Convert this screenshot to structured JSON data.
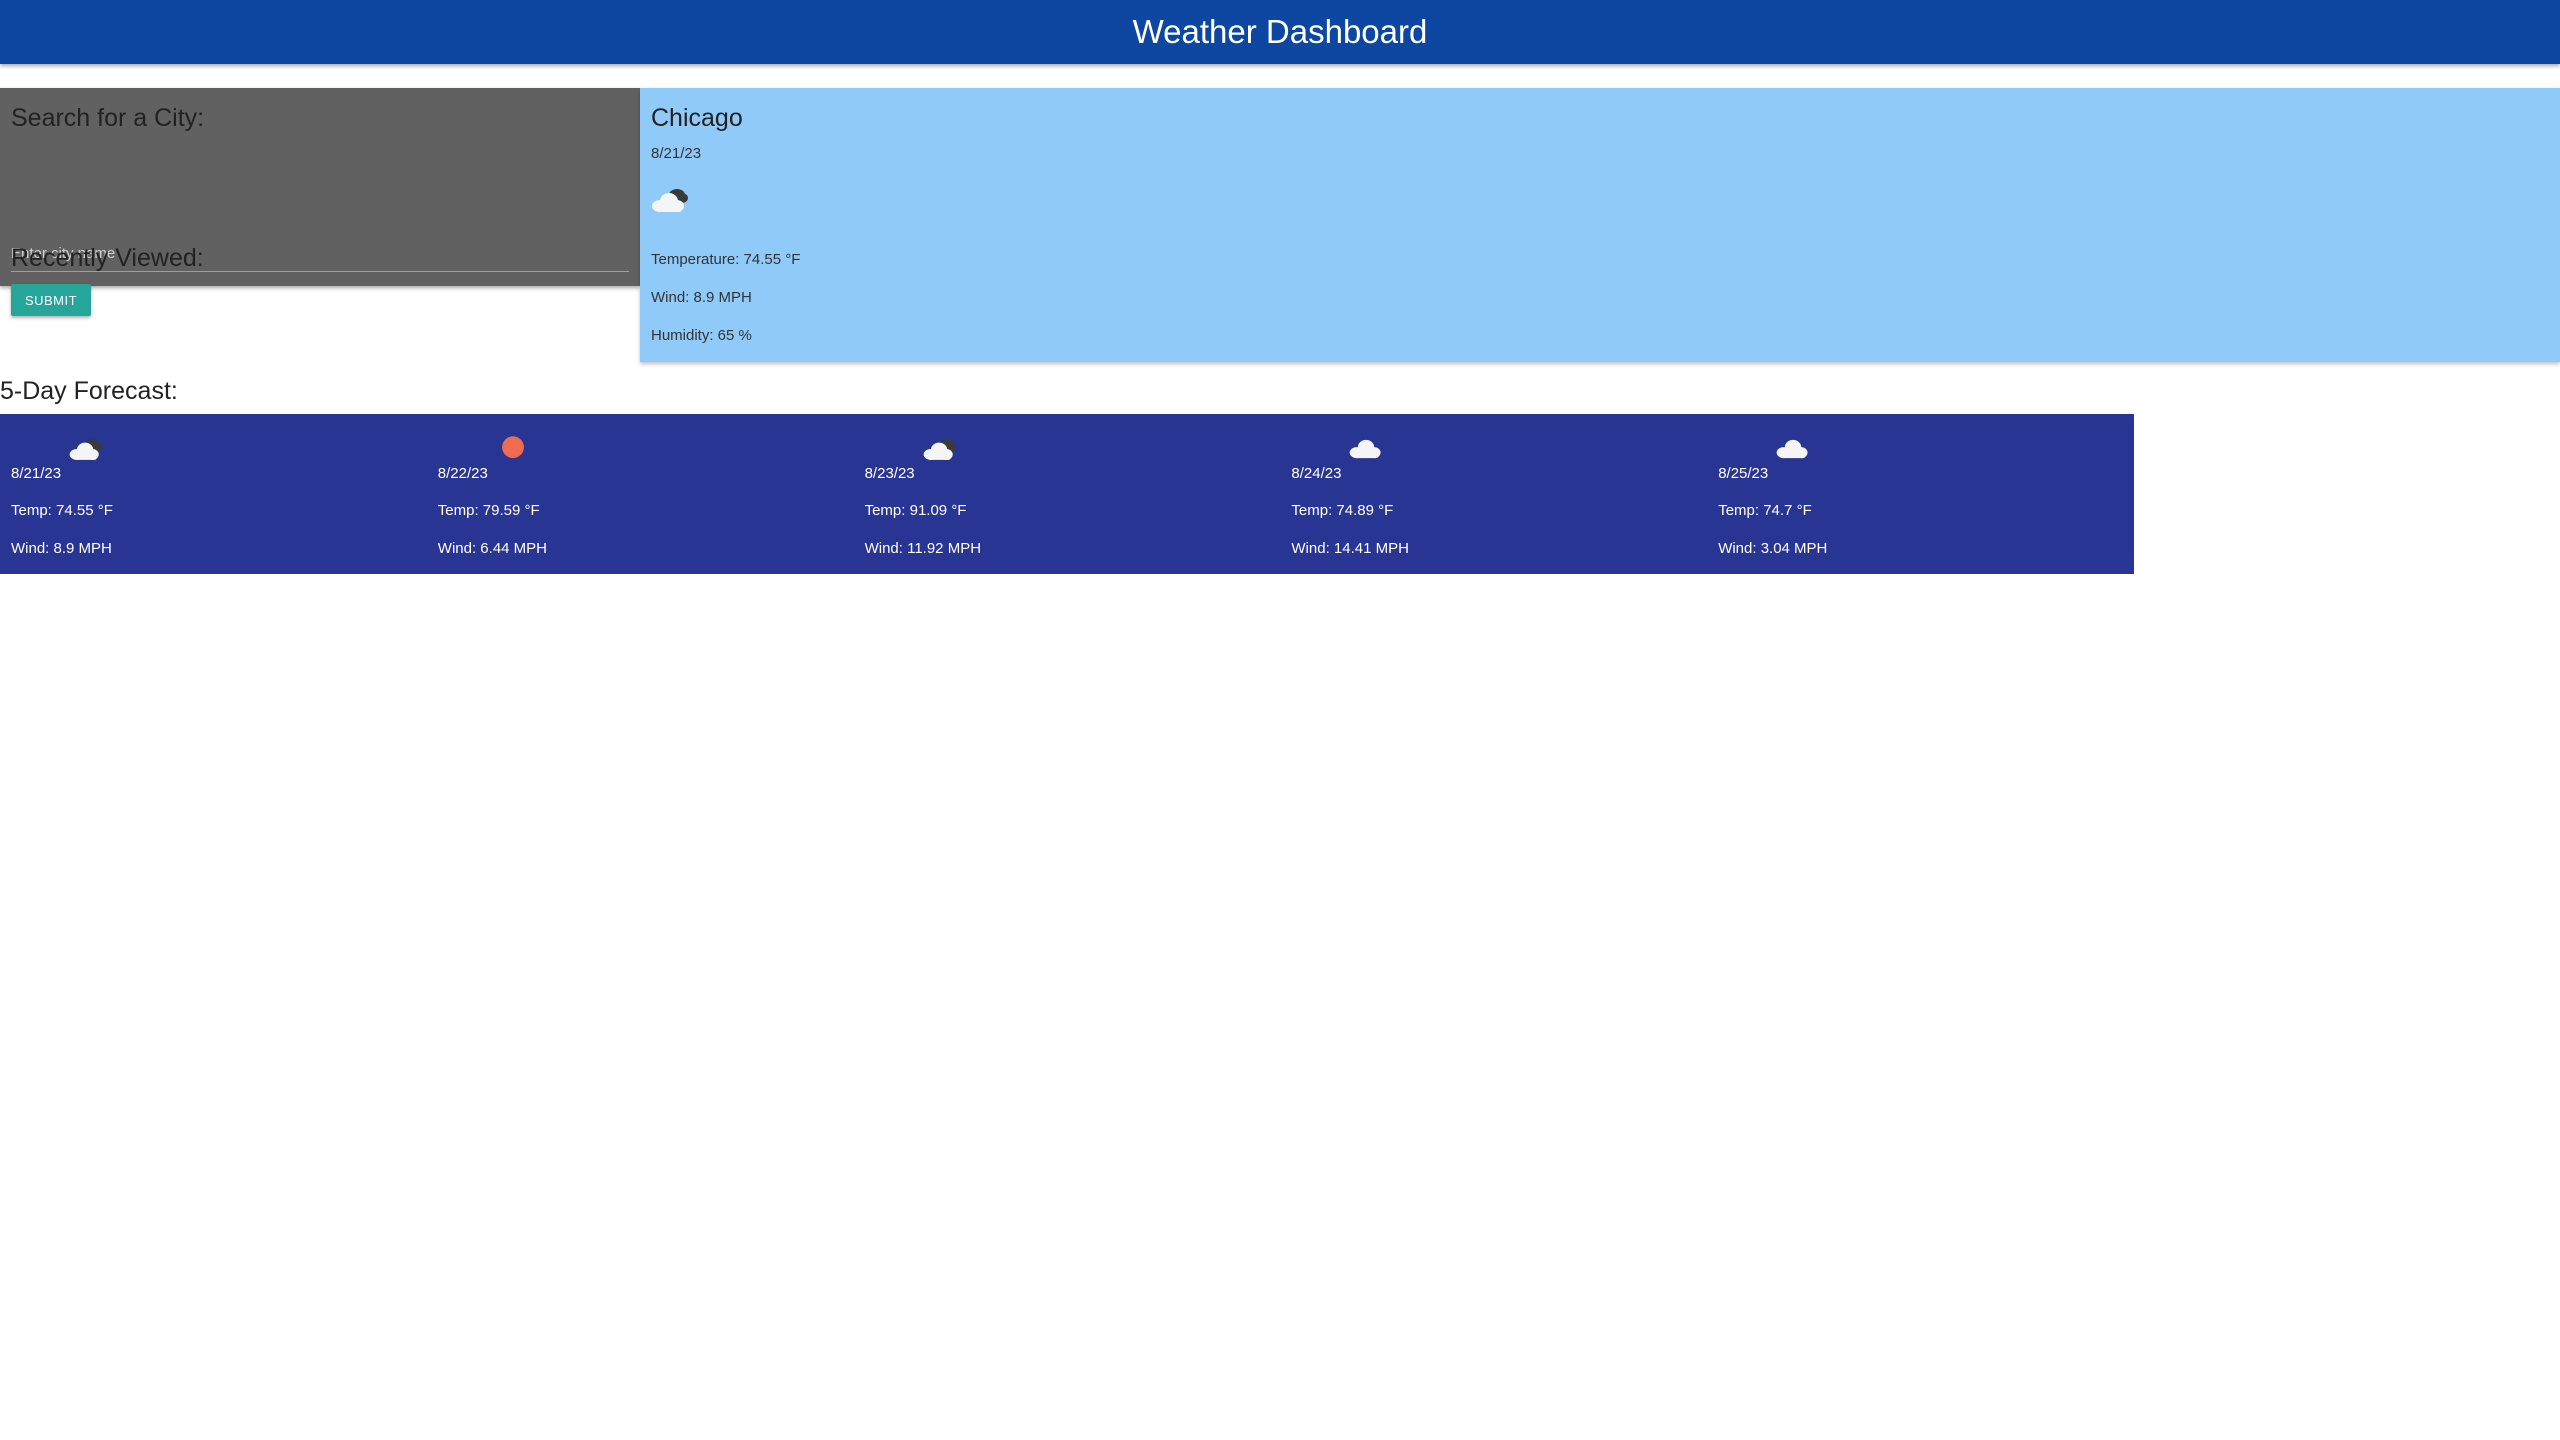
{
  "header": {
    "title": "Weather Dashboard"
  },
  "search": {
    "title": "Search for a City:",
    "placeholder": "Enter city name",
    "value": "",
    "submit_label": "SUBMIT",
    "recent_title": "Recently Viewed:"
  },
  "current": {
    "city": "Chicago",
    "date": "8/21/23",
    "icon": "partly-cloudy-icon",
    "temperature": "Temperature: 74.55 °F",
    "wind": "Wind: 8.9 MPH",
    "humidity": "Humidity: 65 %"
  },
  "forecast": {
    "heading": "5-Day Forecast:",
    "days": [
      {
        "date": "8/21/23",
        "icon": "partly-cloudy-icon",
        "temp": "Temp: 74.55 °F",
        "wind": "Wind: 8.9 MPH"
      },
      {
        "date": "8/22/23",
        "icon": "sun-icon",
        "temp": "Temp: 79.59 °F",
        "wind": "Wind: 6.44 MPH"
      },
      {
        "date": "8/23/23",
        "icon": "partly-cloudy-icon",
        "temp": "Temp: 91.09 °F",
        "wind": "Wind: 11.92 MPH"
      },
      {
        "date": "8/24/23",
        "icon": "cloud-icon",
        "temp": "Temp: 74.89 °F",
        "wind": "Wind: 14.41 MPH"
      },
      {
        "date": "8/25/23",
        "icon": "cloud-icon",
        "temp": "Temp: 74.7 °F",
        "wind": "Wind: 3.04 MPH"
      }
    ]
  },
  "colors": {
    "header_bg": "#0d47a1",
    "search_bg": "#616161",
    "current_bg": "#90caf9",
    "forecast_bg": "#283593",
    "button_bg": "#26a69a",
    "sun": "#ef6c50"
  }
}
